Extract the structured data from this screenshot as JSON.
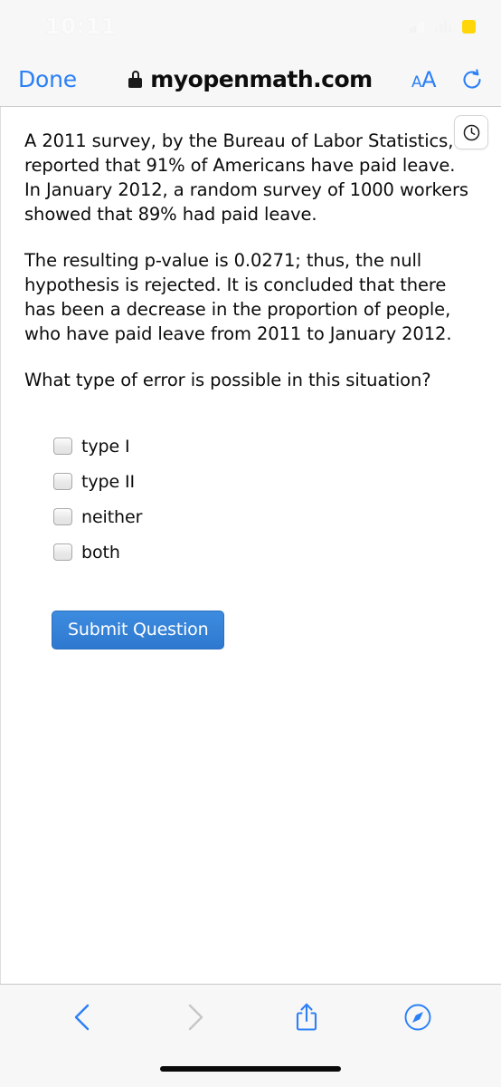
{
  "status_bar": {
    "time": "10:11",
    "signal_icon": "cellular-signal-icon",
    "wifi_icon": "wifi-icon",
    "battery_icon": "battery-low-power-icon",
    "battery_color": "#ffd60a"
  },
  "browser_bar": {
    "done_label": "Done",
    "lock_icon": "lock-icon",
    "url": "myopenmath.com",
    "text_size_small": "A",
    "text_size_large": "A",
    "reload_icon": "reload-icon",
    "accent_color": "#2b80f7"
  },
  "content": {
    "clock_badge_icon": "clock-icon",
    "paragraphs": [
      "A 2011 survey, by the Bureau of Labor Statistics, reported that 91% of Americans have paid leave. In January 2012, a random survey of 1000 workers showed that 89% had paid leave.",
      "The resulting p-value is 0.0271; thus, the null hypothesis is rejected. It is concluded that there has been a decrease in the proportion of people, who have paid leave from 2011 to January 2012."
    ],
    "question": "What type of error is possible in this situation?",
    "choices": [
      {
        "label": "type I",
        "checked": false
      },
      {
        "label": "type II",
        "checked": false
      },
      {
        "label": "neither",
        "checked": false
      },
      {
        "label": "both",
        "checked": false
      }
    ],
    "submit_label": "Submit Question",
    "submit_color": "#2e79cf"
  },
  "bottom_bar": {
    "back_icon": "chevron-left-icon",
    "forward_icon": "chevron-right-icon",
    "share_icon": "share-icon",
    "tabs_icon": "safari-compass-icon",
    "back_enabled": true,
    "forward_enabled": false,
    "home_indicator": "home-indicator"
  }
}
